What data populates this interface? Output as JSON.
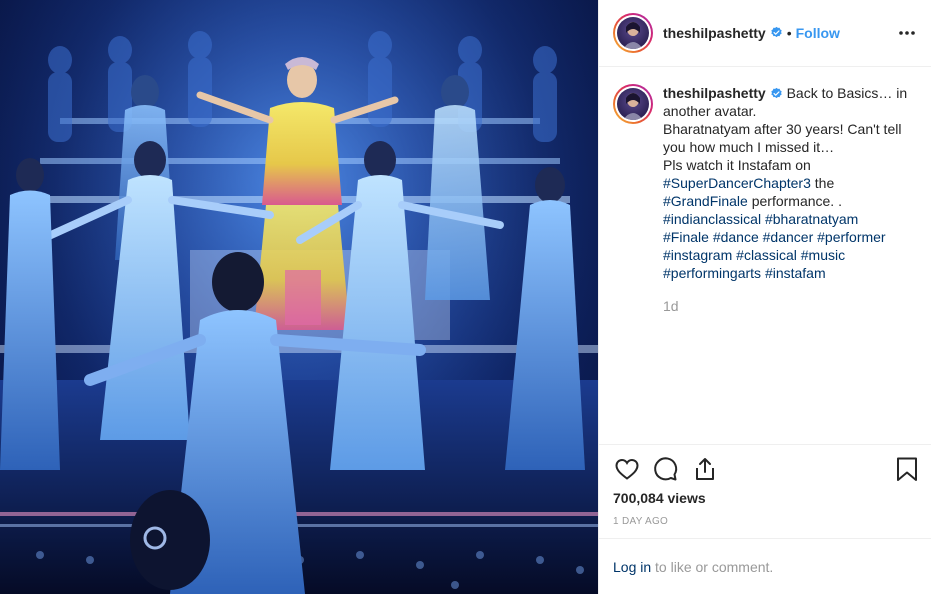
{
  "post": {
    "username": "theshilpashetty",
    "follow_label": "Follow",
    "separator": "•",
    "caption": {
      "line1": "Back to Basics… in another avatar.",
      "line2": "Bharatnatyam after 30 years! Can't tell you how much I missed it…",
      "line3_prefix": "Pls watch it Instafam on",
      "tag_superdancer": "#SuperDancerChapter3",
      "line3_mid": "the",
      "tag_grandfinale": "#GrandFinale",
      "line3_suffix": "performance. .",
      "tags": [
        "#indianclassical",
        "#bharatnatyam",
        "#Finale",
        "#dance",
        "#dancer",
        "#performer",
        "#instagram",
        "#classical",
        "#music",
        "#performingarts",
        "#instafam"
      ]
    },
    "time_ago": "1d",
    "views": "700,084 views",
    "posted": "1 DAY AGO"
  },
  "footer": {
    "login_link": "Log in",
    "login_suffix": "to like or comment."
  },
  "icons": {
    "verified": "verified-badge-icon",
    "more": "more-options-icon",
    "like": "heart-icon",
    "comment": "comment-bubble-icon",
    "share": "share-icon",
    "save": "bookmark-icon"
  },
  "colors": {
    "link_blue": "#3897f0",
    "tag_blue": "#003569",
    "muted": "#999999",
    "text": "#262626"
  }
}
